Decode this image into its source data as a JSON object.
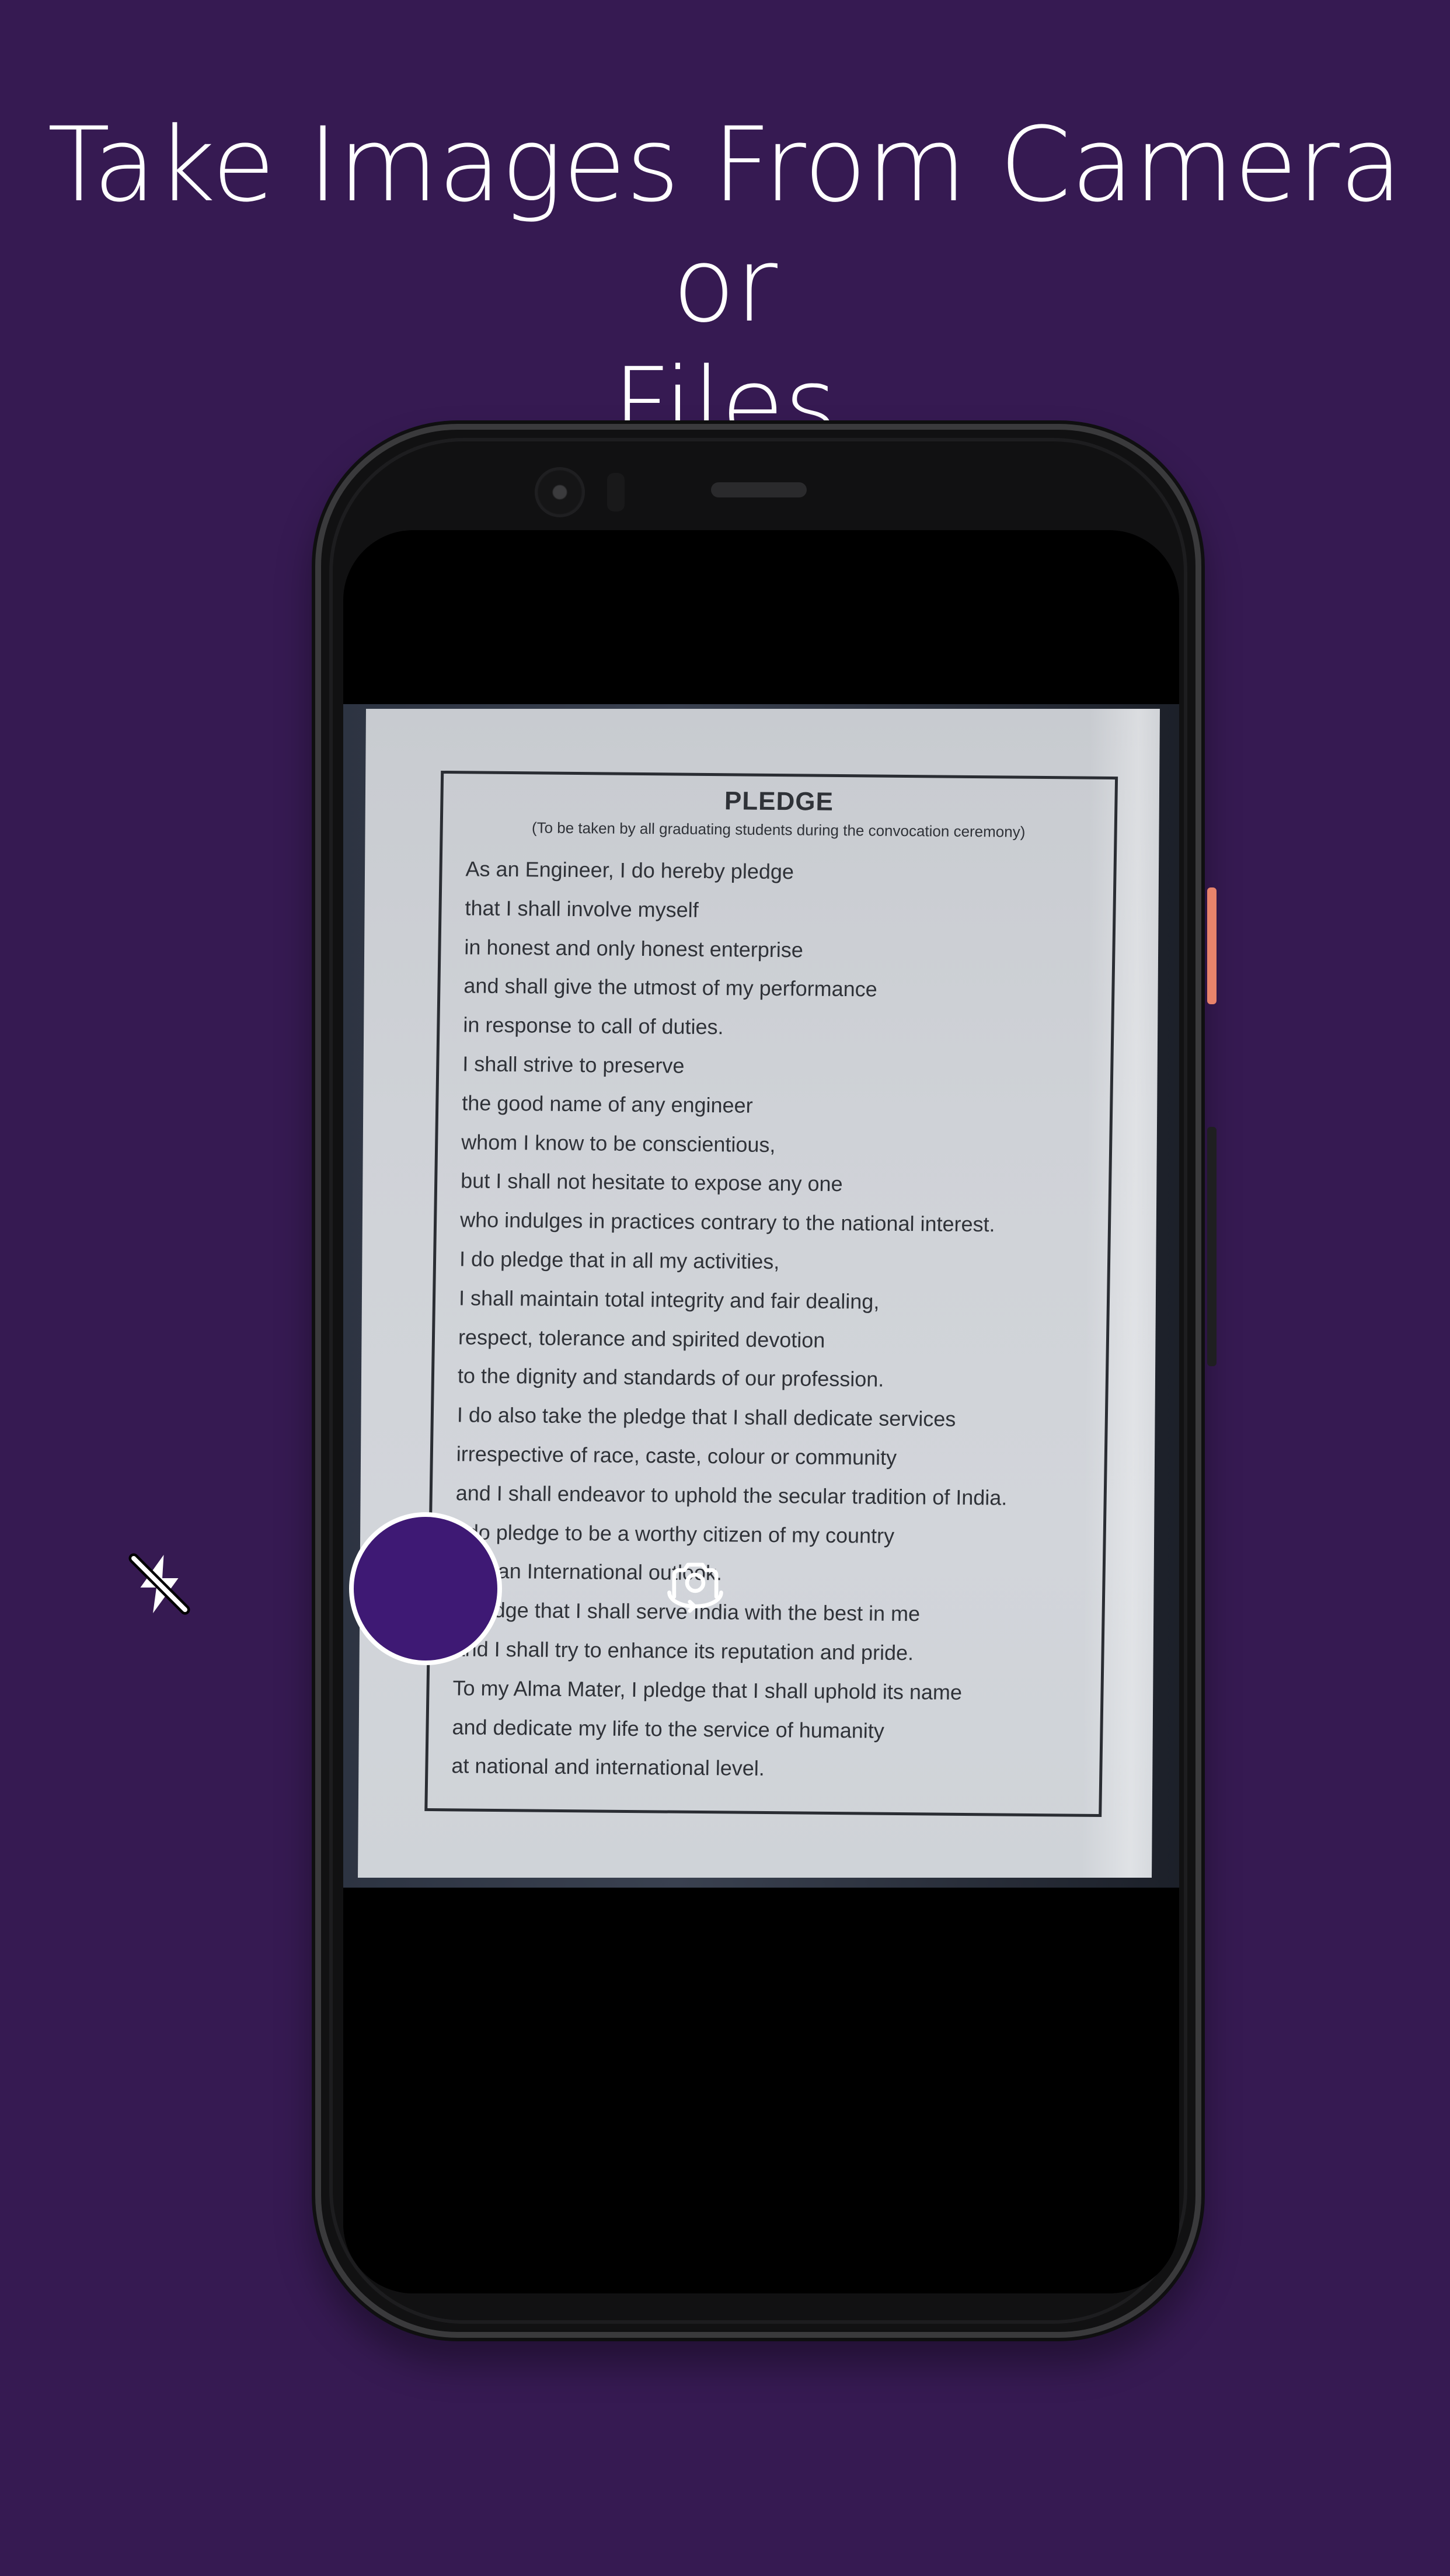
{
  "headline": {
    "line1": "Take Images From Camera or",
    "line2": "Files"
  },
  "document": {
    "title": "PLEDGE",
    "subtitle": "(To be taken by all graduating students during the convocation ceremony)",
    "lines": [
      "As an Engineer, I do hereby pledge",
      "that I shall involve myself",
      "in honest and only honest enterprise",
      "and shall give the utmost of my performance",
      "in response to call of duties.",
      "I shall strive to preserve",
      "the good name of any engineer",
      "whom I know to be conscientious,",
      "but I shall not hesitate to expose any one",
      "who indulges in practices contrary to the national interest.",
      "I do pledge that in all my activities,",
      "I shall maintain total integrity and fair dealing,",
      "respect, tolerance and spirited devotion",
      "to the dignity and standards of our profession.",
      "I do also take the pledge that I shall dedicate services",
      "irrespective of race, caste, colour or community",
      "and I shall endeavor to uphold the secular tradition of India.",
      "I do pledge to be a worthy citizen of my country",
      "with an International outlook.",
      "I pledge that I shall serve India with the best in me",
      "and I shall try to enhance its reputation and pride.",
      "To my Alma Mater, I pledge that I shall uphold its name",
      "and dedicate my life to the service of humanity",
      "at national and international level."
    ]
  },
  "camera_controls": {
    "flash_icon": "flash-off-icon",
    "switch_icon": "switch-camera-icon",
    "shutter_color": "#3e1974"
  },
  "colors": {
    "background": "#361a52",
    "accent": "#3e1974"
  }
}
